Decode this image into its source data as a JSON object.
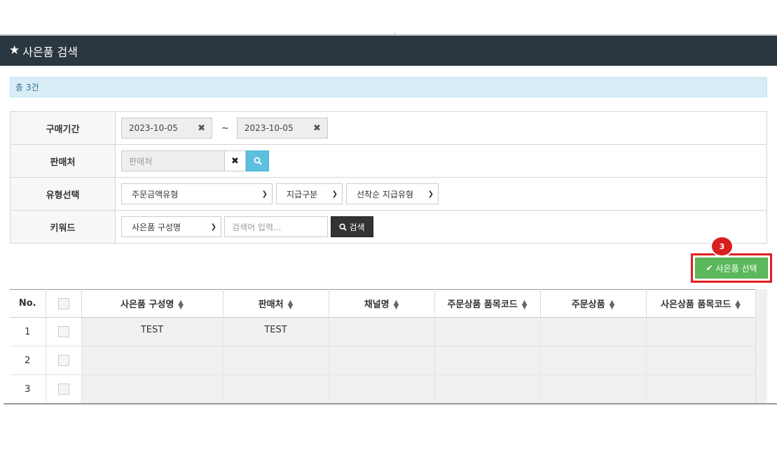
{
  "header": {
    "title": "사은품 검색",
    "icon": "star-icon"
  },
  "summary": {
    "total_text": "총 3건"
  },
  "search": {
    "period": {
      "label": "구매기간",
      "start": "2023-10-05",
      "end": "2023-10-05",
      "separator": "~",
      "clear_glyph": "✖"
    },
    "vendor": {
      "label": "판매처",
      "placeholder": "판매처",
      "clear_glyph": "✖"
    },
    "type": {
      "label": "유형선택",
      "options": [
        "주문금액유형",
        "지급구분",
        "선착순 지급유형"
      ]
    },
    "keyword": {
      "label": "키워드",
      "field_option": "사은품 구성명",
      "placeholder": "검색어 입력...",
      "button_label": "검색"
    }
  },
  "actions": {
    "select_button_label": "사은품 선택",
    "step_badge": "3"
  },
  "grid": {
    "columns": [
      "No.",
      "",
      "사은품 구성명",
      "판매처",
      "채널명",
      "주문상품 품목코드",
      "주문상품",
      "사은상품 품목코드"
    ],
    "rows": [
      {
        "no": "1",
        "name": "TEST",
        "vendor": "TEST",
        "channel": "",
        "order_code": "",
        "order_product": "",
        "gift_code": ""
      },
      {
        "no": "2",
        "name": "",
        "vendor": "",
        "channel": "",
        "order_code": "",
        "order_product": "",
        "gift_code": ""
      },
      {
        "no": "3",
        "name": "",
        "vendor": "",
        "channel": "",
        "order_code": "",
        "order_product": "",
        "gift_code": ""
      }
    ]
  },
  "colors": {
    "header_bg": "#2a3740",
    "info_bg": "#d9edf7",
    "search_btn": "#5bc0de",
    "select_btn": "#5cb85c",
    "highlight": "#e21f1f"
  }
}
